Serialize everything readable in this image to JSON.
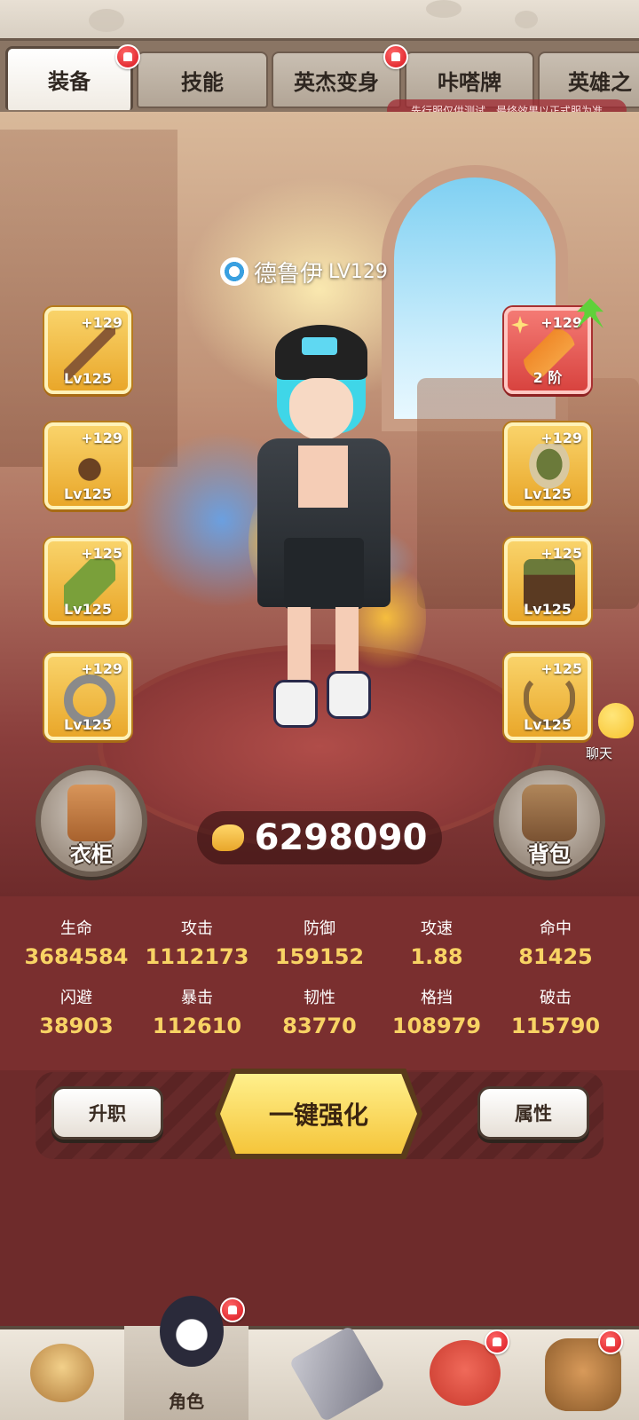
{
  "tabs": [
    {
      "label": "装备",
      "active": true,
      "badge": true
    },
    {
      "label": "技能",
      "active": false,
      "badge": false
    },
    {
      "label": "英杰变身",
      "active": false,
      "badge": true
    },
    {
      "label": "咔嗒牌",
      "active": false,
      "badge": false
    },
    {
      "label": "英雄之",
      "active": false,
      "badge": false
    }
  ],
  "notice": "先行服仅供测试，最终效果以正式服为准",
  "character": {
    "name": "德鲁伊",
    "level": "LV129"
  },
  "equipment_left": [
    {
      "plus": "+129",
      "lv": "Lv125",
      "icon": "staff-icon"
    },
    {
      "plus": "+129",
      "lv": "Lv125",
      "icon": "antler-icon"
    },
    {
      "plus": "+125",
      "lv": "Lv125",
      "icon": "bracer-icon"
    },
    {
      "plus": "+129",
      "lv": "Lv125",
      "icon": "ring-icon"
    }
  ],
  "equipment_right": [
    {
      "plus": "+129",
      "lv": "2 阶",
      "icon": "feather-icon",
      "highlight": true
    },
    {
      "plus": "+129",
      "lv": "Lv125",
      "icon": "hat-icon"
    },
    {
      "plus": "+125",
      "lv": "Lv125",
      "icon": "armor-icon"
    },
    {
      "plus": "+125",
      "lv": "Lv125",
      "icon": "necklace-icon"
    }
  ],
  "wardrobe_label": "衣柜",
  "backpack_label": "背包",
  "power": "6298090",
  "chat_label": "聊天",
  "stats": [
    {
      "name": "生命",
      "value": "3684584"
    },
    {
      "name": "攻击",
      "value": "1112173"
    },
    {
      "name": "防御",
      "value": "159152"
    },
    {
      "name": "攻速",
      "value": "1.88"
    },
    {
      "name": "命中",
      "value": "81425"
    },
    {
      "name": "闪避",
      "value": "38903"
    },
    {
      "name": "暴击",
      "value": "112610"
    },
    {
      "name": "韧性",
      "value": "83770"
    },
    {
      "name": "格挡",
      "value": "108979"
    },
    {
      "name": "破击",
      "value": "115790"
    }
  ],
  "actions": {
    "promote": "升职",
    "enhance_all": "一键强化",
    "attributes": "属性"
  },
  "bottom_nav": [
    {
      "label": "",
      "icon": "beast-icon",
      "badge": false
    },
    {
      "label": "角色",
      "icon": "character-icon",
      "badge": true,
      "active": true
    },
    {
      "label": "",
      "icon": "sword-icon",
      "badge": false
    },
    {
      "label": "",
      "icon": "pet-icon",
      "badge": true
    },
    {
      "label": "",
      "icon": "totem-icon",
      "badge": true
    }
  ],
  "colors": {
    "accent_gold": "#f8d364",
    "badge_red": "#d8131c",
    "slot_gold": "#e9a72a",
    "stat_bg": "#7a2f2f"
  }
}
